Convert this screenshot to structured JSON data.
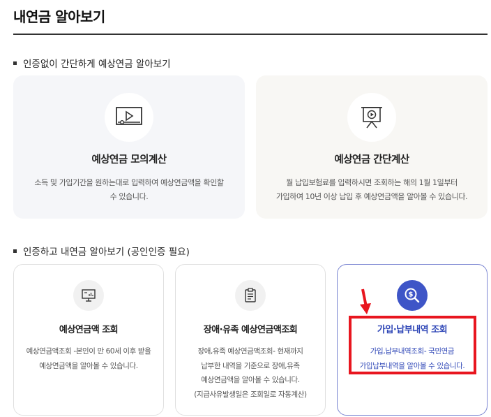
{
  "page": {
    "title": "내연금 알아보기"
  },
  "section1": {
    "heading": "인증없이 간단하게 예상연금 알아보기",
    "cards": [
      {
        "title": "예상연금 모의계산",
        "desc": [
          "소득 및 가입기간을 원하는대로 입력하여 예상연금액을 확인할",
          "수 있습니다."
        ],
        "icon": "video-play-icon"
      },
      {
        "title": "예상연금 간단계산",
        "desc": [
          "월 납입보험료를 입력하시면 조회하는 해의 1월 1일부터",
          "가입하여 10년 이상 납입 후 예상연금액을 알아볼 수 있습니다."
        ],
        "icon": "presentation-board-icon"
      }
    ]
  },
  "section2": {
    "heading": "인증하고 내연금 알아보기 (공인인증 필요)",
    "cards": [
      {
        "title": "예상연금액 조회",
        "desc": [
          "예상연금액조회 -본인이 만 60세 이후 받을",
          "예상연금액을 알아볼 수 있습니다."
        ],
        "icon": "monitor-chart-icon"
      },
      {
        "title": "장애·유족 예상연금액조회",
        "desc": [
          "장애,유족 예상연금액조회- 현재까지",
          "납부한 내역을 기준으로 장애,유족",
          "예상연금액을 알아볼 수 있습니다.",
          "(지급사유발생일은 조회일로 자동계산)"
        ],
        "icon": "clipboard-icon"
      },
      {
        "title": "가입·납부내역 조회",
        "desc": [
          "가입,납부내역조회- 국민연금",
          "가입납부내역을 알아볼 수 있습니다."
        ],
        "icon": "dollar-search-icon"
      }
    ]
  },
  "colors": {
    "accent_blue": "#3e55c7",
    "highlight_red": "#e8161f"
  }
}
